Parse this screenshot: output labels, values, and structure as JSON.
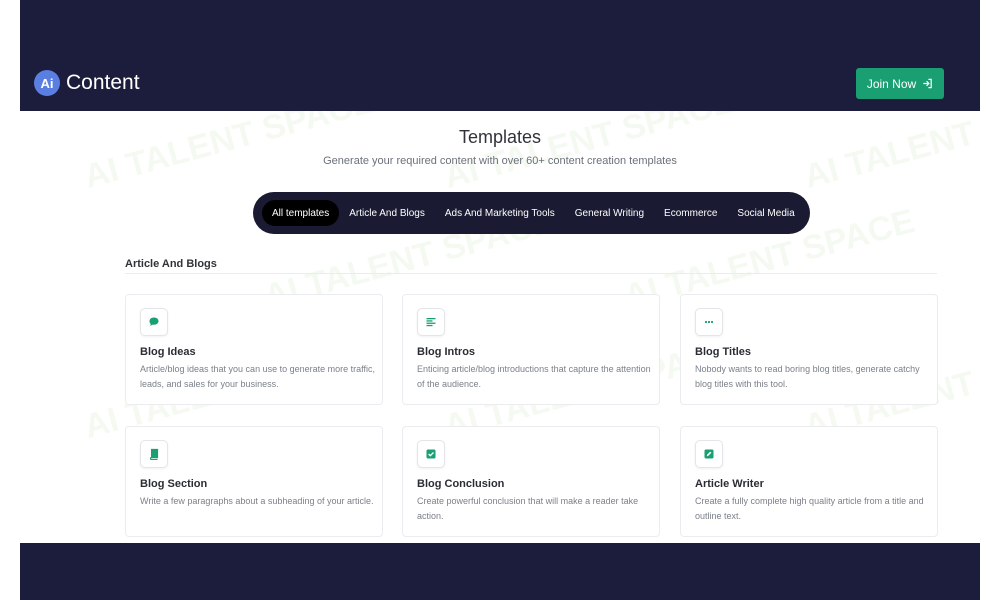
{
  "header": {
    "logo_mark": "Ai",
    "logo_text": "Content",
    "join_label": "Join Now"
  },
  "main": {
    "title": "Templates",
    "subtitle": "Generate your required content with over 60+ content creation templates",
    "tabs": [
      {
        "label": "All templates",
        "active": true
      },
      {
        "label": "Article And Blogs"
      },
      {
        "label": "Ads And Marketing Tools"
      },
      {
        "label": "General Writing"
      },
      {
        "label": "Ecommerce"
      },
      {
        "label": "Social Media"
      }
    ],
    "section_heading": "Article And Blogs",
    "cards": [
      {
        "title": "Blog Ideas",
        "desc": "Article/blog ideas that you can use to generate more traffic, leads, and sales for your business.",
        "icon": "chat-bubble-icon"
      },
      {
        "title": "Blog Intros",
        "desc": "Enticing article/blog introductions that capture the attention of the audience.",
        "icon": "align-text-icon"
      },
      {
        "title": "Blog Titles",
        "desc": "Nobody wants to read boring blog titles, generate catchy blog titles with this tool.",
        "icon": "dots-icon"
      },
      {
        "title": "Blog Section",
        "desc": "Write a few paragraphs about a subheading of your article.",
        "icon": "book-icon"
      },
      {
        "title": "Blog Conclusion",
        "desc": "Create powerful conclusion that will make a reader take action.",
        "icon": "check-square-icon"
      },
      {
        "title": "Article Writer",
        "desc": "Create a fully complete high quality article from a title and outline text.",
        "icon": "edit-square-icon"
      }
    ]
  },
  "colors": {
    "header_bg": "#1c1c3c",
    "accent": "#1a9f72",
    "tabbar_bg": "#1a1a33"
  }
}
